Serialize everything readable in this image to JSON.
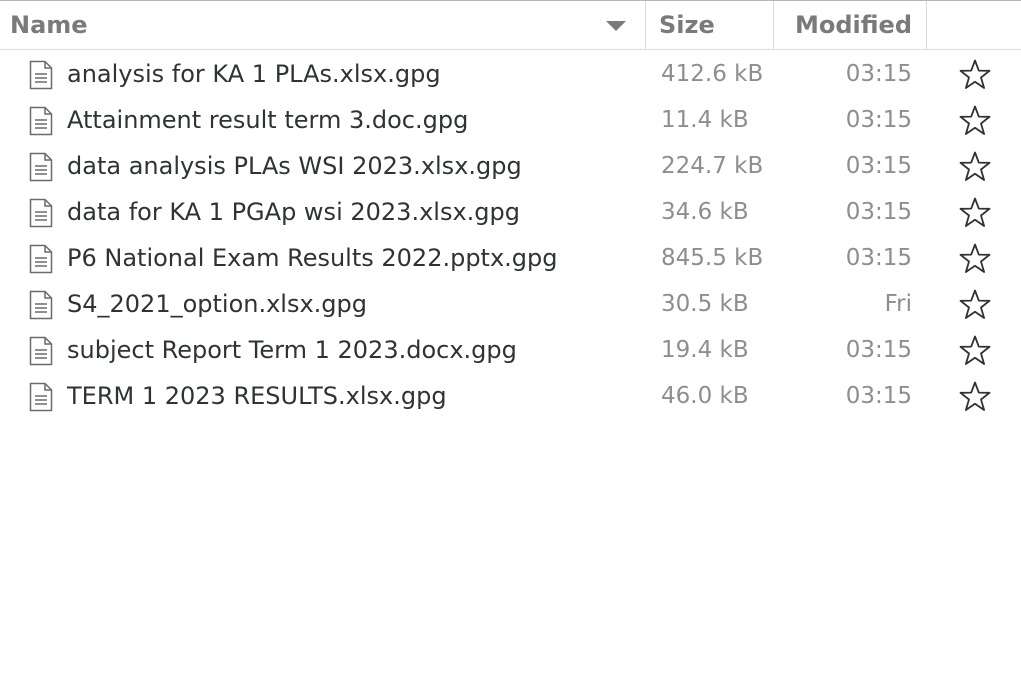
{
  "header": {
    "name_label": "Name",
    "size_label": "Size",
    "modified_label": "Modified"
  },
  "files": [
    {
      "name": "analysis for KA 1 PLAs.xlsx.gpg",
      "size": "412.6 kB",
      "modified": "03:15",
      "icon": "document-icon",
      "starred": false
    },
    {
      "name": "Attainment result term 3.doc.gpg",
      "size": "11.4 kB",
      "modified": "03:15",
      "icon": "document-icon",
      "starred": false
    },
    {
      "name": "data analysis PLAs WSI 2023.xlsx.gpg",
      "size": "224.7 kB",
      "modified": "03:15",
      "icon": "document-icon",
      "starred": false
    },
    {
      "name": "data for KA 1 PGAp wsi 2023.xlsx.gpg",
      "size": "34.6 kB",
      "modified": "03:15",
      "icon": "document-icon",
      "starred": false
    },
    {
      "name": "P6 National Exam Results 2022.pptx.gpg",
      "size": "845.5 kB",
      "modified": "03:15",
      "icon": "document-icon",
      "starred": false
    },
    {
      "name": "S4_2021_option.xlsx.gpg",
      "size": "30.5 kB",
      "modified": "Fri",
      "icon": "document-icon",
      "starred": false
    },
    {
      "name": "subject Report Term 1 2023.docx.gpg",
      "size": "19.4 kB",
      "modified": "03:15",
      "icon": "document-icon",
      "starred": false
    },
    {
      "name": "TERM 1 2023 RESULTS.xlsx.gpg",
      "size": "46.0 kB",
      "modified": "03:15",
      "icon": "document-icon",
      "starred": false
    }
  ],
  "colors": {
    "text_primary": "#2e3436",
    "text_secondary": "#8e8e8e",
    "header_text": "#7a7a7a",
    "divider": "#dcdcdc"
  }
}
